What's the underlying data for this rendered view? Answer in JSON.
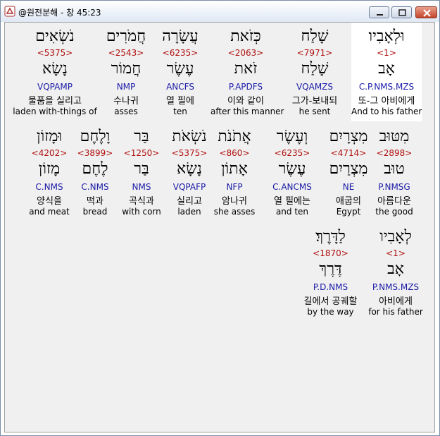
{
  "window": {
    "title": "@원전분해 - 창 45:23"
  },
  "words": [
    {
      "heb": "וּלְאָבִיו",
      "strong": "<1>",
      "lemma": "אָב",
      "morph": "C.P.NMS.MZS",
      "kor": "또-그 아비에게",
      "eng": "And to his father"
    },
    {
      "heb": "שָׁלַח",
      "strong": "<7971>",
      "lemma": "שָׁלַח",
      "morph": "VQAMZS",
      "kor": "그가-보내되",
      "eng": "he sent"
    },
    {
      "heb": "כְּזֹאת",
      "strong": "<2063>",
      "lemma": "זֹאת",
      "morph": "P.APDFS",
      "kor": "이와 같이",
      "eng": "after this manner"
    },
    {
      "heb": "עֲשָׂרָה",
      "strong": "<6235>",
      "lemma": "עֶשֶׂר",
      "morph": "ANCFS",
      "kor": "열 필에",
      "eng": "ten"
    },
    {
      "heb": "חֲמֹרִים",
      "strong": "<2543>",
      "lemma": "חֲמוֹר",
      "morph": "NMP",
      "kor": "수나귀",
      "eng": "asses"
    },
    {
      "heb": "נֹשְׂאִים",
      "strong": "<5375>",
      "lemma": "נָשָׂא",
      "morph": "VQPAMP",
      "kor": "물품을 실리고",
      "eng": "laden with-things of"
    },
    {
      "heb": "מִטּוּב",
      "strong": "<2898>",
      "lemma": "טוּב",
      "morph": "P.NMSG",
      "kor": "아름다운",
      "eng": "the good"
    },
    {
      "heb": "מִצְרָיִם",
      "strong": "<4714>",
      "lemma": "מִצְרַיִם",
      "morph": "NE",
      "kor": "애굽의",
      "eng": "Egypt"
    },
    {
      "heb": "וְעֶשֶׂר",
      "strong": "<6235>",
      "lemma": "עֶשֶׂר",
      "morph": "C.ANCMS",
      "kor": "열 필에는",
      "eng": "and ten"
    },
    {
      "heb": "אֲתֹנֹת",
      "strong": "<860>",
      "lemma": "אָתוֹן",
      "morph": "NFP",
      "kor": "암나귀",
      "eng": "she asses"
    },
    {
      "heb": "נֹשְׂאֹת",
      "strong": "<5375>",
      "lemma": "נָשָׂא",
      "morph": "VQPAFP",
      "kor": "실리고",
      "eng": "laden"
    },
    {
      "heb": "בַּר",
      "strong": "<1250>",
      "lemma": "בַּר",
      "morph": "NMS",
      "kor": "곡식과",
      "eng": "with corn"
    },
    {
      "heb": "וָלֶחֶם",
      "strong": "<3899>",
      "lemma": "לֶחֶם",
      "morph": "C.NMS",
      "kor": "떡과",
      "eng": "bread"
    },
    {
      "heb": "וּמָזוֹן",
      "strong": "<4202>",
      "lemma": "מָזוֹן",
      "morph": "C.NMS",
      "kor": "양식을",
      "eng": "and meat"
    },
    {
      "heb": "לְאָבִיו",
      "strong": "<1>",
      "lemma": "אָב",
      "morph": "P.NMS.MZS",
      "kor": "아비에게",
      "eng": "for his father"
    },
    {
      "heb": "לַדָּרֶךְ׃",
      "strong": "<1870>",
      "lemma": "דֶּרֶךְ",
      "morph": "P.D.NMS",
      "kor": "길에서 공궤할",
      "eng": "by the way"
    }
  ]
}
